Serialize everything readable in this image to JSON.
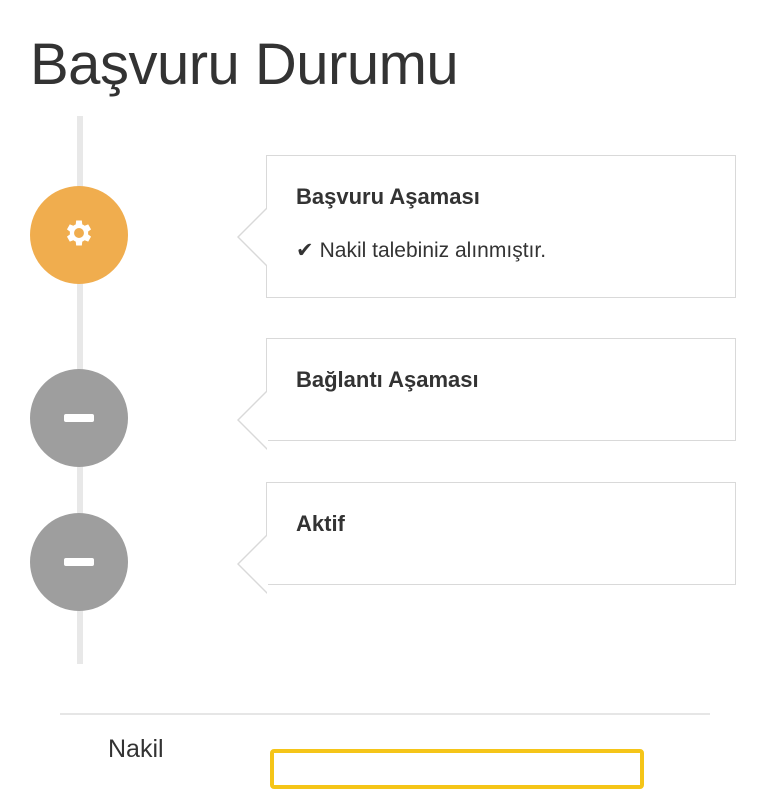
{
  "page": {
    "title": "Başvuru Durumu"
  },
  "timeline": {
    "steps": [
      {
        "title": "Başvuru Aşaması",
        "status": "Nakil talebiniz alınmıştır.",
        "state": "active",
        "icon": "gear-icon"
      },
      {
        "title": "Bağlantı Aşaması",
        "status": "",
        "state": "pending",
        "icon": "minus-icon"
      },
      {
        "title": "Aktif",
        "status": "",
        "state": "pending",
        "icon": "minus-icon"
      }
    ]
  },
  "form": {
    "field_label": "Nakil",
    "field_value": ""
  },
  "colors": {
    "active": "#f0ad4e",
    "pending": "#9e9e9e",
    "input_border": "#f5c518"
  }
}
